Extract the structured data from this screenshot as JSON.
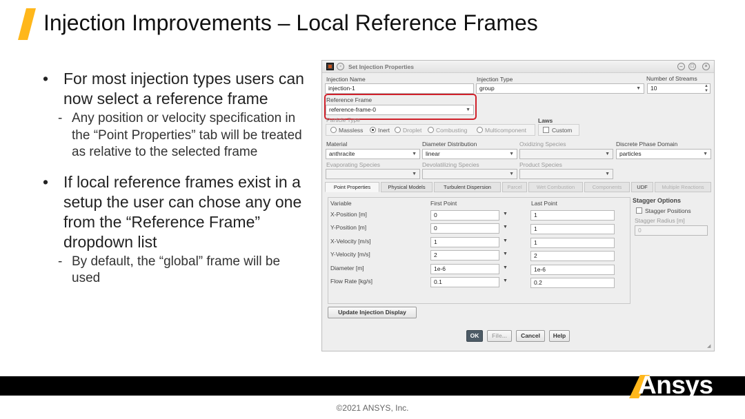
{
  "slide": {
    "title": "Injection Improvements – Local Reference Frames",
    "accent_color": "#ffb71b"
  },
  "bullets": [
    {
      "text": "For most injection types users can now select a reference frame",
      "sub": "Any position or velocity specification in the “Point Properties” tab will be treated as relative to the selected frame"
    },
    {
      "text": "If local reference frames exist in a setup the user can chose any one from the “Reference Frame” dropdown list",
      "sub": "By default, the “global” frame will be used"
    }
  ],
  "dialog": {
    "title": "Set Injection Properties",
    "injection_name_label": "Injection Name",
    "injection_name_value": "injection-1",
    "injection_type_label": "Injection Type",
    "injection_type_value": "group",
    "streams_label": "Number of Streams",
    "streams_value": "10",
    "reference_frame_label": "Reference Frame",
    "reference_frame_value": "reference-frame-0",
    "highlight_color": "#d0202a",
    "particle_type_label": "Particle Type",
    "particle_types": [
      "Massless",
      "Inert",
      "Droplet",
      "Combusting",
      "Multicomponent"
    ],
    "particle_type_selected": "Inert",
    "laws_label": "Laws",
    "custom_label": "Custom",
    "material_label": "Material",
    "material_value": "anthracite",
    "diameter_dist_label": "Diameter Distribution",
    "diameter_dist_value": "linear",
    "oxidizing_label": "Oxidizing Species",
    "dpd_label": "Discrete Phase Domain",
    "dpd_value": "particles",
    "evaporating_label": "Evaporating Species",
    "devolatilizing_label": "Devolatilizing Species",
    "product_label": "Product Species",
    "tabs": [
      "Point Properties",
      "Physical Models",
      "Turbulent Dispersion",
      "Parcel",
      "Wet Combustion",
      "Components",
      "UDF",
      "Multiple Reactions"
    ],
    "table": {
      "col_variable": "Variable",
      "col_first": "First Point",
      "col_last": "Last Point",
      "rows": [
        {
          "label": "X-Position [m]",
          "first": "0",
          "last": "1"
        },
        {
          "label": "Y-Position [m]",
          "first": "0",
          "last": "1"
        },
        {
          "label": "X-Velocity [m/s]",
          "first": "1",
          "last": "1"
        },
        {
          "label": "Y-Velocity [m/s]",
          "first": "2",
          "last": "2"
        },
        {
          "label": "Diameter [m]",
          "first": "1e-6",
          "last": "1e-6"
        },
        {
          "label": "Flow Rate [kg/s]",
          "first": "0.1",
          "last": "0.2"
        }
      ]
    },
    "stagger": {
      "title": "Stagger Options",
      "positions_label": "Stagger Positions",
      "radius_label": "Stagger Radius [m]",
      "radius_value": "0"
    },
    "update_button": "Update Injection Display",
    "buttons": {
      "ok": "OK",
      "file": "File...",
      "cancel": "Cancel",
      "help": "Help"
    }
  },
  "footer": {
    "logo_text": "Ansys",
    "copyright": "©2021 ANSYS, Inc."
  }
}
